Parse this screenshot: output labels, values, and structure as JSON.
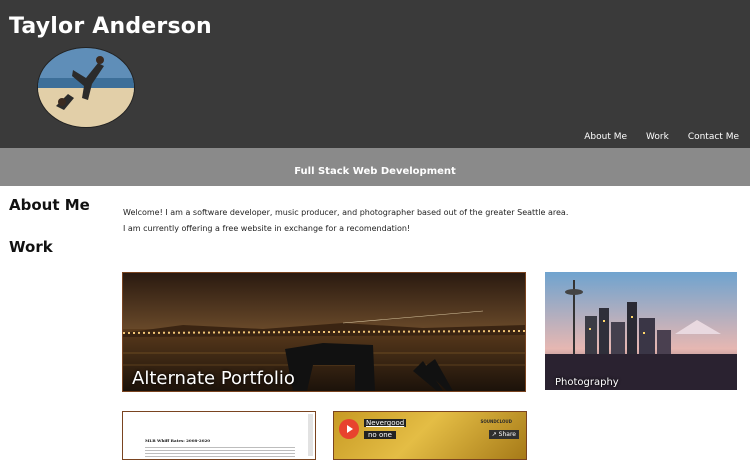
{
  "header": {
    "title": "Taylor Anderson",
    "nav": [
      "About Me",
      "Work",
      "Contact Me"
    ]
  },
  "subheader": "Full Stack Web Development",
  "sidebar": [
    "About Me",
    "Work"
  ],
  "intro": [
    "Welcome! I am a software developer, music producer, and photographer based out of the greater Seattle area.",
    "I am currently offering a free website in exchange for a recomendation!"
  ],
  "tiles": {
    "portfolio": "Alternate Portfolio",
    "photography": "Photography",
    "doc_heading": "MLB Whiff Rates: 2008-2020",
    "player": {
      "artist": "Nevergood",
      "track": "no one",
      "share": "Share",
      "service": "SOUNDCLOUD"
    }
  },
  "colors": {
    "header_bg": "#3a3a3a",
    "subheader_bg": "#8a8a8a"
  }
}
